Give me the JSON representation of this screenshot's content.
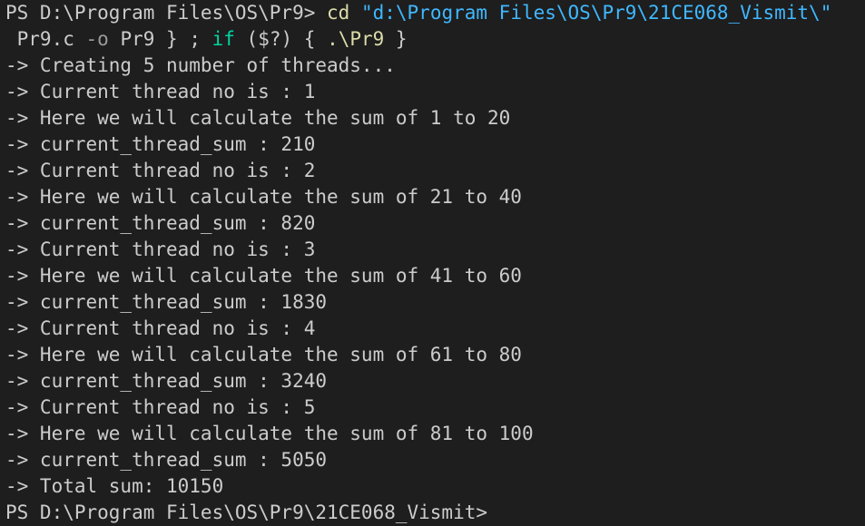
{
  "terminal": {
    "prompt_line_1": {
      "prompt": "PS D:\\Program Files\\OS\\Pr9> ",
      "command": "cd",
      "space": " ",
      "path": "\"d:\\Program Files\\OS\\Pr9\\21CE068_Vismit\\\""
    },
    "prompt_line_2": {
      "file": " Pr9.c ",
      "flag": "-o",
      "target": " Pr9 } ; ",
      "if_kw": "if",
      "condition": " ($?) { ",
      "exec": ".\\Pr9",
      "close": " }"
    },
    "output_lines": [
      "-> Creating 5 number of threads...",
      "-> Current thread no is : 1",
      "-> Here we will calculate the sum of 1 to 20",
      "-> current_thread_sum : 210",
      "-> Current thread no is : 2",
      "-> Here we will calculate the sum of 21 to 40",
      "-> current_thread_sum : 820",
      "-> Current thread no is : 3",
      "-> Here we will calculate the sum of 41 to 60",
      "-> current_thread_sum : 1830",
      "-> Current thread no is : 4",
      "-> Here we will calculate the sum of 61 to 80",
      "-> current_thread_sum : 3240",
      "-> Current thread no is : 5",
      "-> Here we will calculate the sum of 81 to 100",
      "-> current_thread_sum : 5050",
      "-> Total sum: 10150"
    ],
    "final_prompt": "PS D:\\Program Files\\OS\\Pr9\\21CE068_Vismit>"
  },
  "colors": {
    "background": "#1e1e1e",
    "text": "#cccccc",
    "command": "#dcdcaa",
    "string": "#3fb8ff",
    "keyword": "#00d7a0",
    "flag": "#9a9a9a"
  }
}
